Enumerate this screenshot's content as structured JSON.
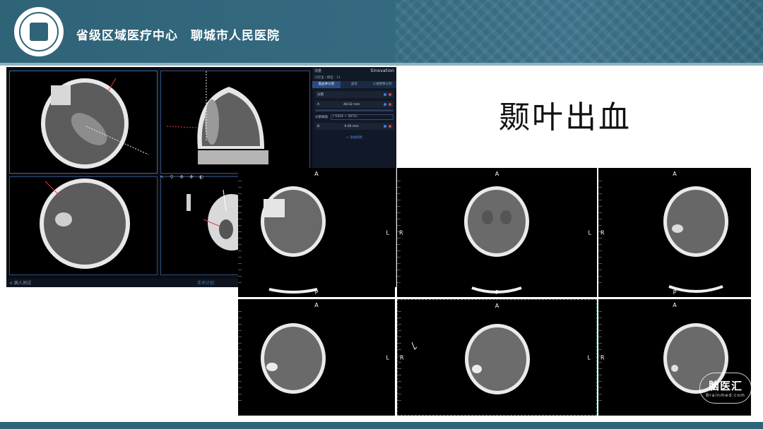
{
  "header": {
    "title": "省级区域医疗中心　聊城市人民医院",
    "logo_icon": "hospital-seal-logo",
    "bg_color": "#2f6378"
  },
  "slide": {
    "title": "颞叶出血"
  },
  "software": {
    "brand": "Sinovation",
    "user": "测量",
    "subtitle": "口腔里 / 模型 · 11",
    "tabs": [
      "脑血肿分割",
      "器官",
      "三维图像分割"
    ],
    "measure_header": "分割",
    "item_a_label": "A",
    "item_a_value": "48.02 mm",
    "select_label": "分割阈值",
    "select_value": "(-1024 ~ 3071)",
    "item_b_label": "B",
    "item_b_value": "0.00 mm",
    "add_link": "+ 添加结构",
    "back_link": "< 病人测试",
    "status_center": "手术计划",
    "tool_icons": [
      "pointer-icon",
      "zoom-icon",
      "pan-icon",
      "crosshair-icon",
      "contrast-icon"
    ]
  },
  "ct_panels": [
    {
      "id": "ct1",
      "top": "A",
      "bottom": "P",
      "left": "",
      "right": "L"
    },
    {
      "id": "ct2",
      "top": "A",
      "bottom": "P",
      "left": "R",
      "right": "L"
    },
    {
      "id": "ct3",
      "top": "A",
      "bottom": "P",
      "left": "R",
      "right": ""
    },
    {
      "id": "ct4",
      "top": "A",
      "bottom": "",
      "left": "",
      "right": "L"
    },
    {
      "id": "ct5",
      "top": "A",
      "bottom": "",
      "left": "R",
      "right": "L"
    },
    {
      "id": "ct6",
      "top": "A",
      "bottom": "",
      "left": "R",
      "right": ""
    }
  ],
  "watermark": {
    "main": "脑医汇",
    "sub": "Brainmed.com"
  }
}
